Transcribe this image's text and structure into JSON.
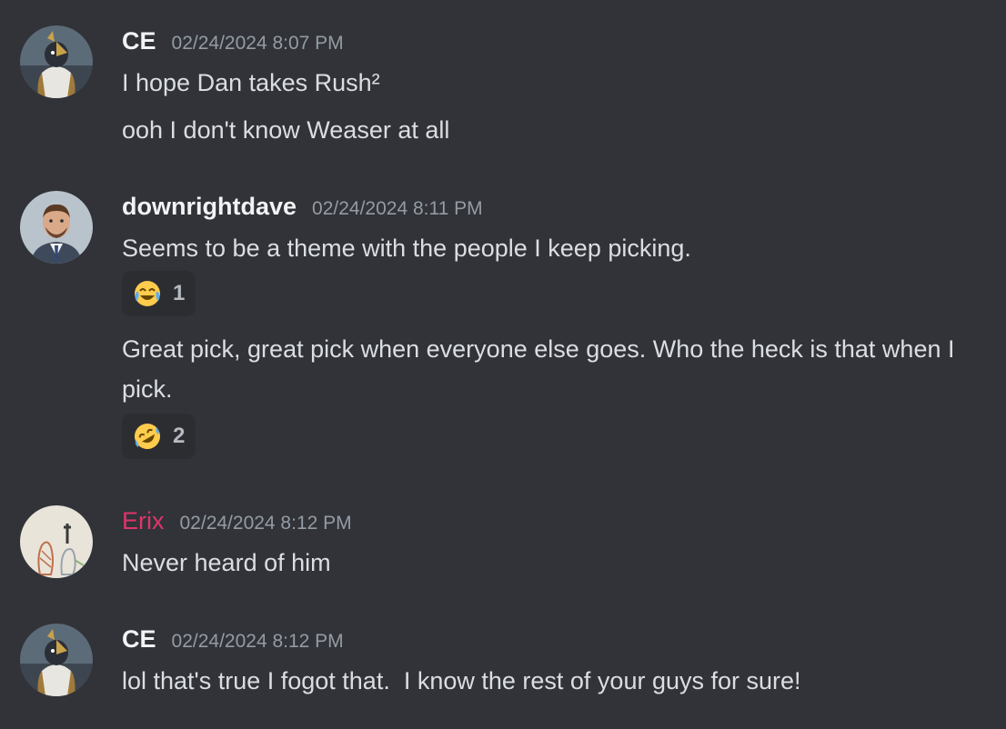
{
  "messages": [
    {
      "author": "CE",
      "timestamp": "02/24/2024 8:07 PM",
      "avatar": "knight-avatar",
      "lines": [
        "I hope Dan takes Rush²",
        "ooh I don't know Weaser at all"
      ]
    },
    {
      "author": "downrightdave",
      "timestamp": "02/24/2024 8:11 PM",
      "avatar": "man-portrait-avatar",
      "lines": [
        "Seems to be a theme with the people I keep picking.",
        "Great pick, great pick when everyone else goes. Who the heck is that when I pick."
      ],
      "reactions": [
        {
          "emoji": "joy",
          "count": "1"
        },
        {
          "emoji": "rofl",
          "count": "2"
        }
      ]
    },
    {
      "author": "Erix",
      "author_color": "#e0356b",
      "timestamp": "02/24/2024 8:12 PM",
      "avatar": "sketch-avatar",
      "lines": [
        "Never heard of him"
      ]
    },
    {
      "author": "CE",
      "timestamp": "02/24/2024 8:12 PM",
      "avatar": "knight-avatar",
      "lines": [
        "lol that's true I fogot that.  I know the rest of your guys for sure!"
      ]
    }
  ],
  "colors": {
    "background": "#313338",
    "text": "#dbdee1",
    "timestamp": "#949ba4",
    "reaction_bg": "#2b2d31"
  }
}
